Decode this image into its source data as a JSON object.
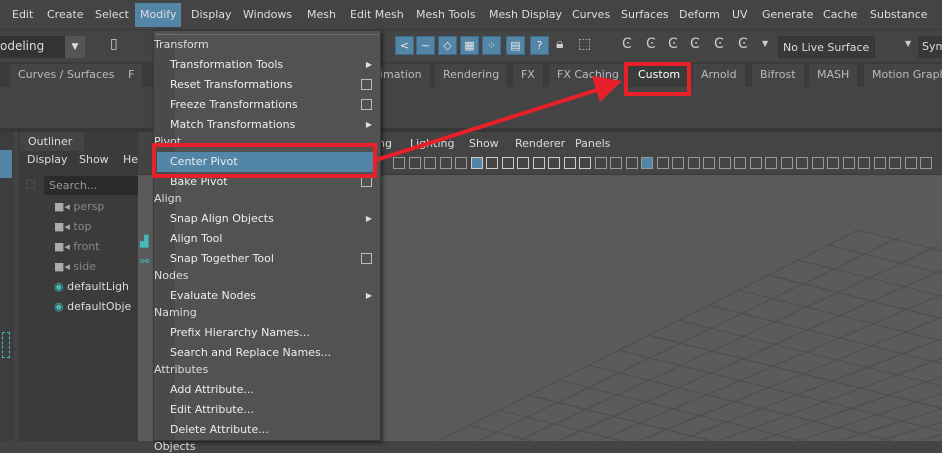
{
  "menubar": [
    "Edit",
    "Create",
    "Select",
    "Modify",
    "Display",
    "Windows",
    "Mesh",
    "Edit Mesh",
    "Mesh Tools",
    "Mesh Display",
    "Curves",
    "Surfaces",
    "Deform",
    "UV",
    "Generate",
    "Cache",
    "Substance"
  ],
  "toolbar": {
    "mode": "odeling",
    "live_surface": "No Live Surface",
    "symmetry": "Sym"
  },
  "shelf_tabs": [
    "Curves / Surfaces",
    "F",
    "imation",
    "Rendering",
    "FX",
    "FX Caching",
    "Custom",
    "Arnold",
    "Bifrost",
    "MASH",
    "Motion Graph"
  ],
  "outliner": {
    "tab": "Outliner",
    "menu": [
      "Display",
      "Show",
      "He"
    ],
    "search_placeholder": "Search...",
    "items": [
      {
        "label": "persp",
        "type": "camera"
      },
      {
        "label": "top",
        "type": "camera"
      },
      {
        "label": "front",
        "type": "camera"
      },
      {
        "label": "side",
        "type": "camera"
      },
      {
        "label": "defaultLigh",
        "type": "set"
      },
      {
        "label": "defaultObje",
        "type": "set"
      }
    ]
  },
  "viewport": {
    "menu": [
      "ng",
      "Lighting",
      "Show",
      "Renderer",
      "Panels"
    ]
  },
  "modify_menu": [
    {
      "type": "header",
      "label": "Transform"
    },
    {
      "type": "item",
      "label": "Transformation Tools",
      "suffix": "arrow"
    },
    {
      "type": "item",
      "label": "Reset Transformations",
      "suffix": "box"
    },
    {
      "type": "item",
      "label": "Freeze Transformations",
      "suffix": "box"
    },
    {
      "type": "item",
      "label": "Match Transformations",
      "suffix": "arrow"
    },
    {
      "type": "header",
      "label": "Pivot"
    },
    {
      "type": "item",
      "label": "Center Pivot",
      "selected": true
    },
    {
      "type": "item",
      "label": "Bake Pivot",
      "suffix": "box"
    },
    {
      "type": "header",
      "label": "Align"
    },
    {
      "type": "item",
      "label": "Snap Align Objects",
      "suffix": "arrow"
    },
    {
      "type": "item",
      "label": "Align Tool"
    },
    {
      "type": "item",
      "label": "Snap Together Tool",
      "suffix": "box"
    },
    {
      "type": "header",
      "label": "Nodes"
    },
    {
      "type": "item",
      "label": "Evaluate Nodes",
      "suffix": "arrow"
    },
    {
      "type": "header",
      "label": "Naming"
    },
    {
      "type": "item",
      "label": "Prefix Hierarchy Names..."
    },
    {
      "type": "item",
      "label": "Search and Replace Names..."
    },
    {
      "type": "header",
      "label": "Attributes"
    },
    {
      "type": "item",
      "label": "Add Attribute..."
    },
    {
      "type": "item",
      "label": "Edit Attribute..."
    },
    {
      "type": "item",
      "label": "Delete Attribute..."
    },
    {
      "type": "header",
      "label": "Objects"
    }
  ],
  "colors": {
    "accent": "#5285a6",
    "annotation": "#e8202a"
  }
}
